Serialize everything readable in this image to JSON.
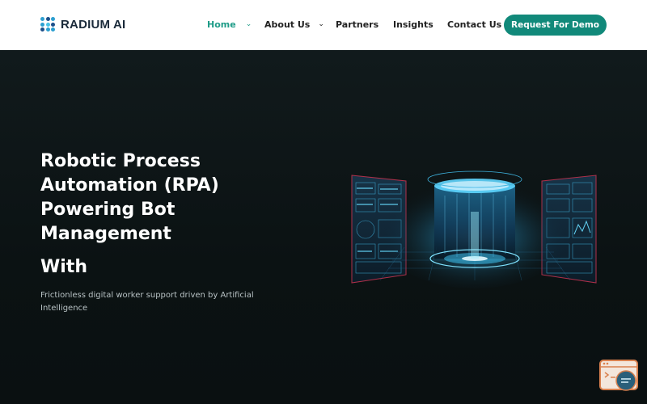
{
  "brand": {
    "name": "RADIUM AI"
  },
  "nav": {
    "items": [
      {
        "label": "Home",
        "has_dropdown": true,
        "active": true
      },
      {
        "label": "About Us",
        "has_dropdown": true,
        "active": false
      },
      {
        "label": "Partners",
        "has_dropdown": false,
        "active": false
      },
      {
        "label": "Insights",
        "has_dropdown": false,
        "active": false
      },
      {
        "label": "Contact Us",
        "has_dropdown": false,
        "active": false
      }
    ],
    "cta_label": "Request For Demo"
  },
  "hero": {
    "title": "Robotic Process Automation (RPA) Powering Bot Management",
    "with_label": "With",
    "subtitle": "Frictionless digital worker support driven by Artificial Intelligence"
  },
  "icons": {
    "dropdown": "chevron-down-icon",
    "chat": "chat-widget-icon"
  },
  "colors": {
    "accent": "#11897a",
    "active_nav": "#1f9c88",
    "header_bg": "#ffffff",
    "hero_bg": "#0b1112",
    "text_light": "#ffffff"
  }
}
